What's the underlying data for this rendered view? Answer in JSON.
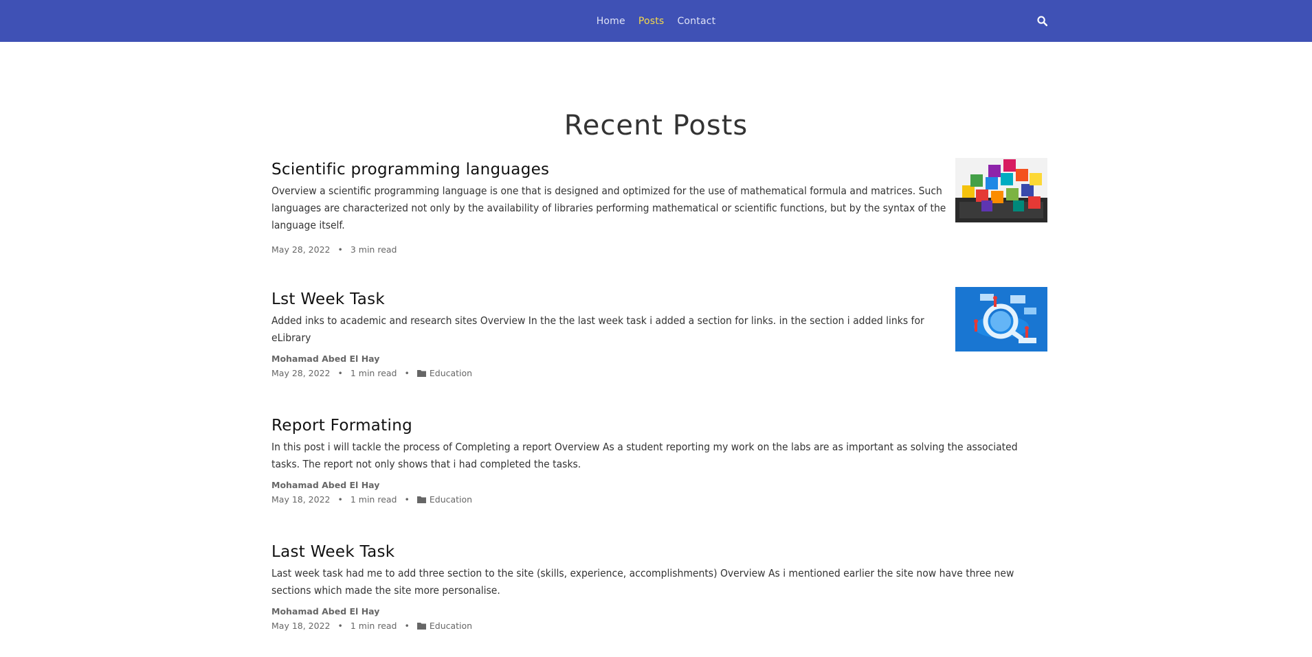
{
  "nav": {
    "links": [
      {
        "label": "Home",
        "active": false
      },
      {
        "label": "Posts",
        "active": true
      },
      {
        "label": "Contact",
        "active": false
      }
    ],
    "search_icon": "search-icon"
  },
  "page": {
    "title": "Recent Posts"
  },
  "posts": [
    {
      "title": "Scientific programming languages",
      "excerpt": "Overview a scientific programming language is one that is designed and optimized for the use of mathematical formula and matrices. Such languages are characterized not only by the availability of libraries performing mathematical or scientific functions, but by the syntax of the language itself.",
      "date": "May 28, 2022",
      "read_time": "3 min read",
      "thumbnail": "programming-languages-image"
    },
    {
      "title": "Lst Week Task",
      "excerpt": "Added inks to academic and research sites Overview In the the last week task i added a section for links. in the section i added links for eLibrary",
      "author": "Mohamad Abed El Hay",
      "date": "May 28, 2022",
      "read_time": "1 min read",
      "category": "Education",
      "thumbnail": "research-search-image"
    },
    {
      "title": "Report Formating",
      "excerpt": "In this post i will tackle the process of Completing a report Overview As a student reporting my work on the labs are as important as solving the associated tasks. The report not only shows that i had completed the tasks.",
      "author": "Mohamad Abed El Hay",
      "date": "May 18, 2022",
      "read_time": "1 min read",
      "category": "Education"
    },
    {
      "title": "Last Week Task",
      "excerpt": "Last week task had me to add three section to the site (skills, experience, accomplishments) Overview As i mentioned earlier the site now have three new sections which made the site more personalise.",
      "author": "Mohamad Abed El Hay",
      "date": "May 18, 2022",
      "read_time": "1 min read",
      "category": "Education"
    }
  ],
  "meta_separator": "•",
  "colors": {
    "navbar": "#3f51b5",
    "nav_active": "#f5d94a",
    "nav_text": "#dfe3f7"
  }
}
